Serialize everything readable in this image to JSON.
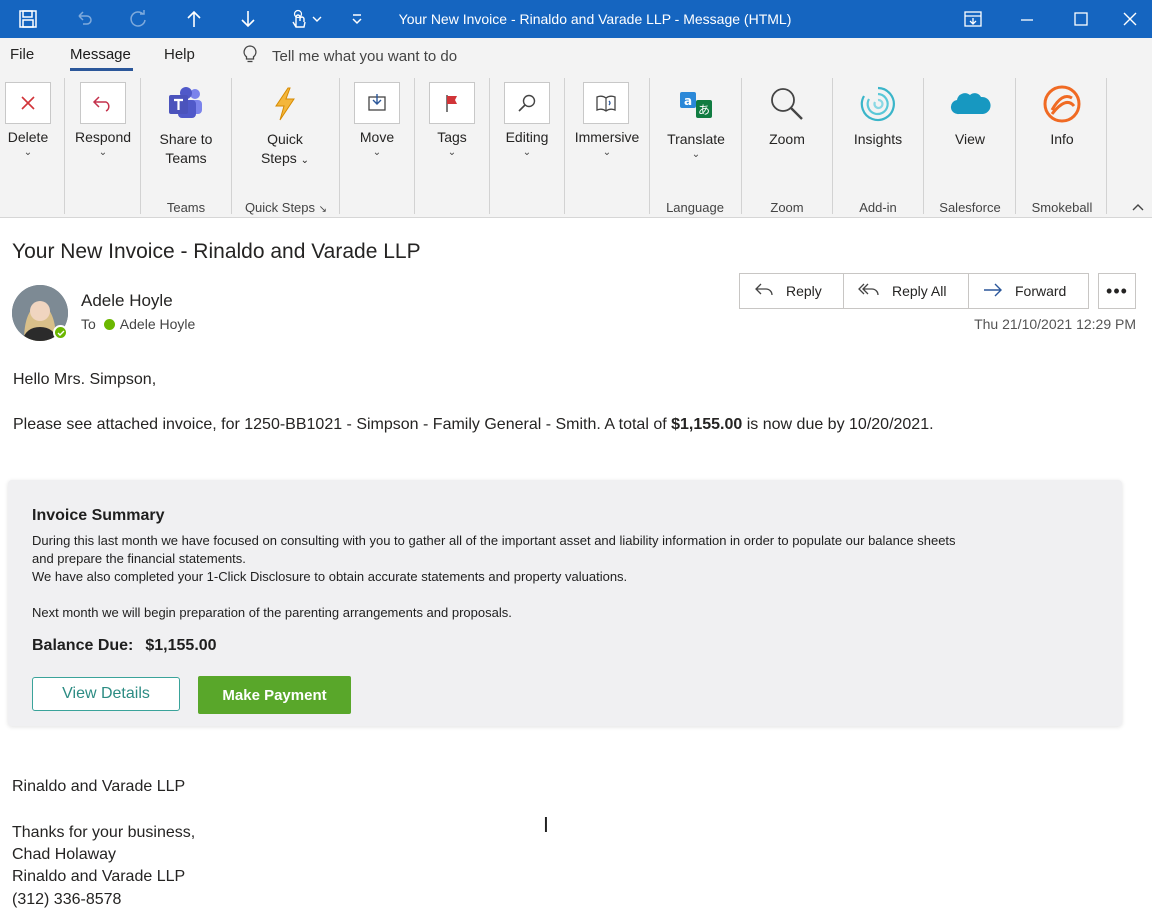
{
  "window": {
    "title": "Your New Invoice - Rinaldo and Varade LLP  -  Message (HTML)",
    "controls": [
      "restore-ribbon-icon",
      "minimize-icon",
      "maximize-icon",
      "close-icon"
    ]
  },
  "quick_access": [
    "save-icon",
    "undo-icon",
    "redo-icon",
    "up-arrow-icon",
    "down-arrow-icon",
    "touch-mode-icon",
    "customize-icon"
  ],
  "menu": {
    "items": [
      "File",
      "Message",
      "Help"
    ],
    "active": "Message",
    "tell_me": "Tell me what you want to do"
  },
  "ribbon": {
    "buttons": {
      "delete": "Delete",
      "respond": "Respond",
      "share_teams_1": "Share to",
      "share_teams_2": "Teams",
      "quick_steps_1": "Quick",
      "quick_steps_2": "Steps",
      "move": "Move",
      "tags": "Tags",
      "editing": "Editing",
      "immersive": "Immersive",
      "translate": "Translate",
      "zoom": "Zoom",
      "insights": "Insights",
      "view": "View",
      "info": "Info"
    },
    "groups": {
      "teams": "Teams",
      "quick_steps": "Quick Steps",
      "language": "Language",
      "zoom": "Zoom",
      "addin": "Add-in",
      "salesforce": "Salesforce",
      "smokeball": "Smokeball"
    }
  },
  "message": {
    "subject": "Your New Invoice - Rinaldo and Varade LLP",
    "sender": "Adele Hoyle",
    "to_label": "To",
    "recipient": "Adele Hoyle",
    "timestamp": "Thu 21/10/2021 12:29 PM",
    "actions": {
      "reply": "Reply",
      "reply_all": "Reply All",
      "forward": "Forward",
      "more": "•••"
    }
  },
  "body": {
    "greeting": "Hello Mrs. Simpson,",
    "intro_before": "Please see attached invoice, for 1250-BB1021 - Simpson - Family General - Smith. A total of ",
    "intro_amount": "$1,155.00",
    "intro_after": " is now due by 10/20/2021."
  },
  "invoice": {
    "title": "Invoice Summary",
    "line1": "During this last month we have focused on consulting with you to gather all of the important asset and liability information in order to populate our balance sheets",
    "line2": "and prepare the financial statements.",
    "line3": "We have also completed your 1-Click Disclosure to obtain accurate statements and property valuations.",
    "line4": "Next month we will begin preparation of the parenting arrangements and proposals.",
    "balance_label": "Balance Due:",
    "balance_value": "$1,155.00",
    "view_details": "View Details",
    "make_payment": "Make Payment",
    "accent_color": "#59a72a",
    "outline_color": "#3aa39a"
  },
  "signature": {
    "firm_line": "Rinaldo and Varade LLP",
    "thanks": "Thanks for your business,",
    "name": "Chad Holaway",
    "firm": "Rinaldo and Varade LLP",
    "phone": "(312) 336-8578"
  },
  "colors": {
    "titlebar": "#1565c0",
    "ribbon_bg": "#f3f3f3",
    "presence": "#6bb700"
  }
}
